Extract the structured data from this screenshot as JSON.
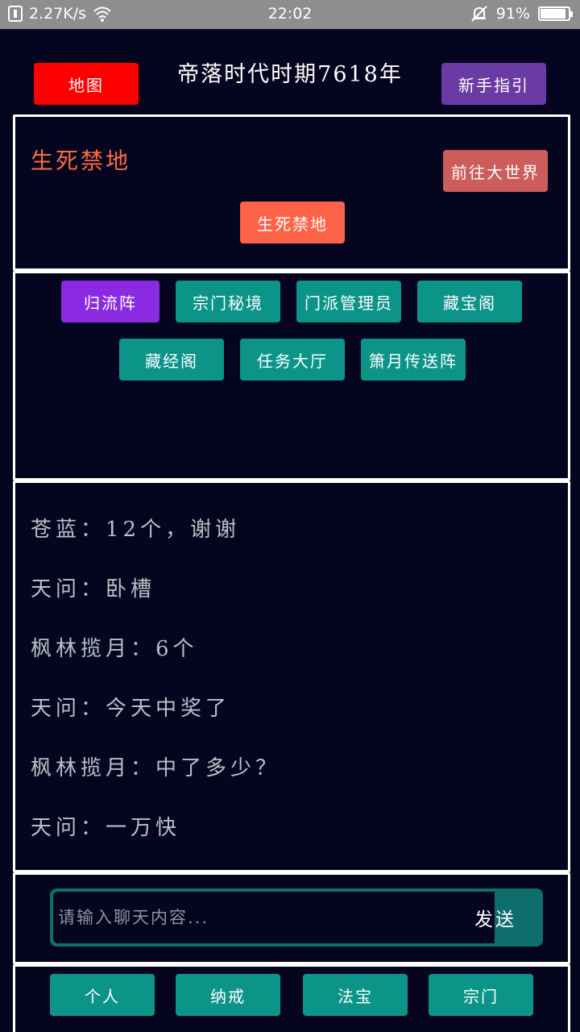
{
  "status_bar": {
    "network_speed": "2.27K/s",
    "time": "22:02",
    "battery_percent": "91%",
    "battery_level": 0.91
  },
  "header": {
    "map_button": "地图",
    "title": "帝落时代时期7618年",
    "guide_button": "新手指引"
  },
  "location": {
    "name": "生死禁地",
    "go_world_button": "前往大世界",
    "place_button": "生死禁地"
  },
  "places": [
    {
      "label": "归流阵",
      "color": "#8a2be2"
    },
    {
      "label": "宗门秘境",
      "color": "#0d9488"
    },
    {
      "label": "门派管理员",
      "color": "#0d9488"
    },
    {
      "label": "藏宝阁",
      "color": "#0d9488"
    },
    {
      "label": "藏经阁",
      "color": "#0d9488"
    },
    {
      "label": "任务大厅",
      "color": "#0d9488"
    },
    {
      "label": "箫月传送阵",
      "color": "#0d9488"
    }
  ],
  "chat": {
    "messages": [
      "苍蓝：12个，谢谢",
      "天问：卧槽",
      "枫林揽月：6个",
      "天问：今天中奖了",
      "枫林揽月：中了多少？",
      "天问：一万快"
    ],
    "input_placeholder": "请输入聊天内容...",
    "send_button": "发送"
  },
  "bottom_nav": [
    "个人",
    "纳戒",
    "法宝",
    "宗门"
  ],
  "colors": {
    "background": "#050520",
    "map_button": "#ff0000",
    "guide_button": "#6a3aa5",
    "go_world_button": "#cd5c5c",
    "place_button": "#ff6347",
    "teal": "#0d9488",
    "purple": "#8a2be2",
    "location_text": "#ff6a3d"
  }
}
